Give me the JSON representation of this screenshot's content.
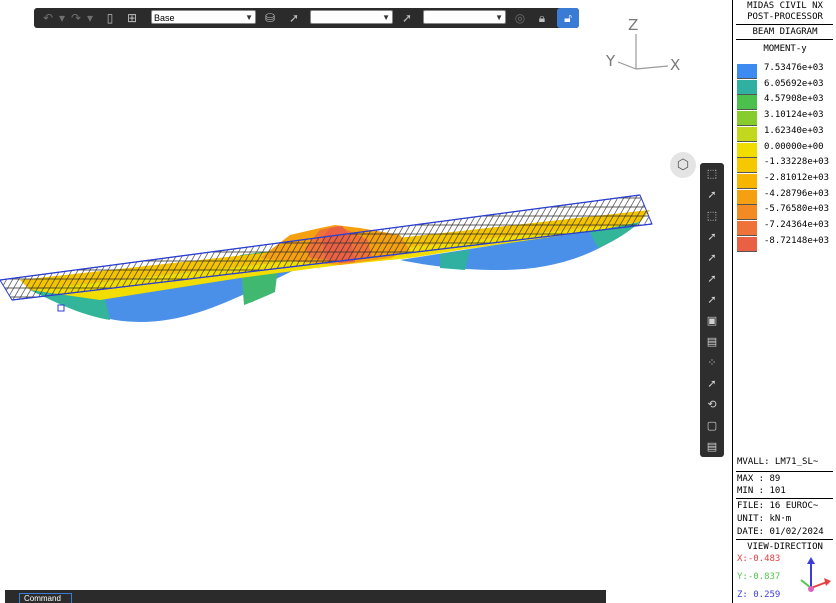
{
  "toolbar": {
    "combo_primary": "Base",
    "combo_secondary": "",
    "combo_tertiary": ""
  },
  "axes": {
    "z": "Z",
    "y": "Y",
    "x": "X"
  },
  "command": {
    "tab_label": "Command"
  },
  "legend": {
    "header_line1": "MIDAS CIVIL NX",
    "header_line2": "POST-PROCESSOR",
    "diagram_type": "BEAM DIAGRAM",
    "component": "MOMENT-y",
    "entries": [
      {
        "value": "7.53476e+03",
        "color": "#3d8af0"
      },
      {
        "value": "6.05692e+03",
        "color": "#2fb0a0"
      },
      {
        "value": "4.57908e+03",
        "color": "#4cc04c"
      },
      {
        "value": "3.10124e+03",
        "color": "#86cc2c"
      },
      {
        "value": "1.62340e+03",
        "color": "#c2d81c"
      },
      {
        "value": "0.00000e+00",
        "color": "#f2dd00"
      },
      {
        "value": "-1.33228e+03",
        "color": "#f6c800"
      },
      {
        "value": "-2.81012e+03",
        "color": "#f7b500"
      },
      {
        "value": "-4.28796e+03",
        "color": "#f5a010"
      },
      {
        "value": "-5.76580e+03",
        "color": "#f38a24"
      },
      {
        "value": "-7.24364e+03",
        "color": "#ef7238"
      },
      {
        "value": "-8.72148e+03",
        "color": "#ea6044"
      }
    ],
    "load": "MVALL: LM71_SL~",
    "max": "MAX : 89",
    "min": "MIN : 101",
    "file": "FILE: 16 EUROC~",
    "unit": "UNIT: kN·m",
    "date": "DATE: 01/02/2024",
    "view_dir_title": "VIEW-DIRECTION",
    "view_x": "X:-0.483",
    "view_y": "Y:-0.837",
    "view_z": "Z: 0.259",
    "color_x": "#e64040",
    "color_y": "#50c850",
    "color_z": "#3c3cdc"
  }
}
